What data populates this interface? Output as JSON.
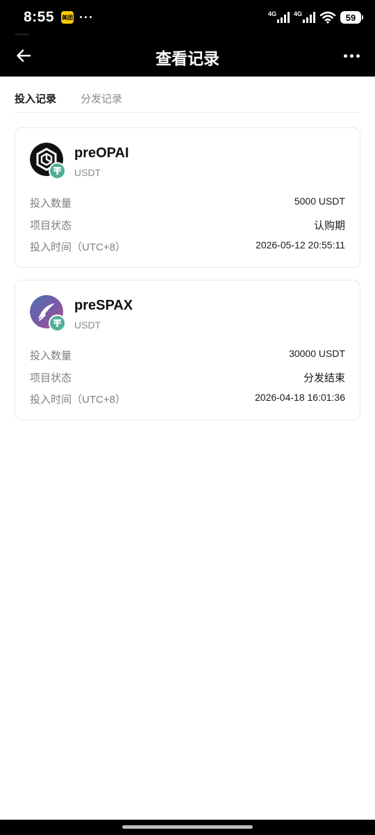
{
  "status_bar": {
    "time": "8:55",
    "app_badge": "美团",
    "dots": "···",
    "net_1": "4G",
    "net_2": "4G",
    "battery": "59"
  },
  "nav": {
    "title": "查看记录",
    "back_icon": "arrow-left-icon",
    "more_icon": "more-dots-icon"
  },
  "tabs": [
    {
      "label": "投入记录",
      "active": true
    },
    {
      "label": "分发记录",
      "active": false
    }
  ],
  "records": [
    {
      "name": "preOPAI",
      "unit": "USDT",
      "logo": "preopai-logo-icon",
      "rows": [
        {
          "label": "投入数量",
          "value": "5000 USDT"
        },
        {
          "label": "项目状态",
          "value": "认购期"
        },
        {
          "label": "投入时间（UTC+8）",
          "value": "2026-05-12 20:55:11"
        }
      ]
    },
    {
      "name": "preSPAX",
      "unit": "USDT",
      "logo": "prespax-logo-icon",
      "rows": [
        {
          "label": "投入数量",
          "value": "30000 USDT"
        },
        {
          "label": "项目状态",
          "value": "分发结束"
        },
        {
          "label": "投入时间（UTC+8）",
          "value": "2026-04-18 16:01:36"
        }
      ]
    }
  ],
  "colors": {
    "header_bg": "#000000",
    "tether_green": "#50af95",
    "label_gray": "#7d7d7d"
  }
}
